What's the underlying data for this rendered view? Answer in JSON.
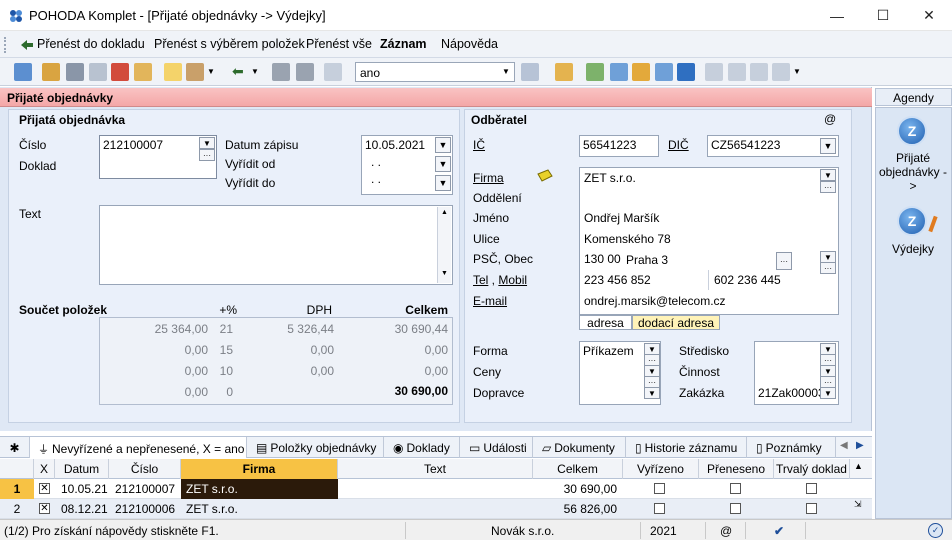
{
  "window": {
    "title": "POHODA Komplet - [Přijaté objednávky -> Výdejky]",
    "min": "—",
    "max": "☐",
    "close": "✕"
  },
  "menu": {
    "items": [
      {
        "label": "Přenést do dokladu"
      },
      {
        "label": "Přenést s výběrem položek"
      },
      {
        "label": "Přenést vše"
      },
      {
        "label": "Záznam"
      },
      {
        "label": "Nápověda"
      }
    ]
  },
  "toolbar": {
    "filter_value": "ano"
  },
  "agenda_header": "Přijaté objednávky",
  "order": {
    "section": "Přijatá objednávka",
    "cislo_label": "Číslo",
    "cislo": "212100007",
    "doklad_label": "Doklad",
    "datum_zapisu_label": "Datum zápisu",
    "datum_zapisu": "10.05.2021",
    "vyridit_od_label": "Vyřídit od",
    "vyridit_od": ". .",
    "vyridit_do_label": "Vyřídit do",
    "vyridit_do": ". .",
    "text_label": "Text",
    "sum_label": "Součet položek",
    "col_pct": "+%",
    "col_dph": "DPH",
    "col_celkem": "Celkem",
    "rows": [
      {
        "base": "25 364,00",
        "pct": "21",
        "dph": "5 326,44",
        "total": "30 690,44"
      },
      {
        "base": "0,00",
        "pct": "15",
        "dph": "0,00",
        "total": "0,00"
      },
      {
        "base": "0,00",
        "pct": "10",
        "dph": "0,00",
        "total": "0,00"
      },
      {
        "base": "0,00",
        "pct": "0",
        "dph": "",
        "total": "30 690,00"
      }
    ]
  },
  "customer": {
    "section": "Odběratel",
    "at": "@",
    "ic_label": "IČ",
    "ic": "56541223",
    "dic_label": "DIČ",
    "dic": "CZ56541223",
    "firma_label": "Firma",
    "firma": "ZET s.r.o.",
    "oddeleni_label": "Oddělení",
    "oddeleni": "",
    "jmeno_label": "Jméno",
    "jmeno": "Ondřej Maršík",
    "ulice_label": "Ulice",
    "ulice": "Komenského 78",
    "psc_label": "PSČ, Obec",
    "psc": "130 00",
    "obec": "Praha 3",
    "tel_label": "Tel",
    "mobil_label": "Mobil",
    "tel": "223 456 852",
    "mobil": "602 236 445",
    "email_label": "E-mail",
    "email": "ondrej.marsik@telecom.cz",
    "tab_adresa": "adresa",
    "tab_dodaci": "dodací adresa",
    "forma_label": "Forma",
    "forma": "Příkazem",
    "ceny_label": "Ceny",
    "dopravce_label": "Dopravce",
    "stredisko_label": "Středisko",
    "cinnost_label": "Činnost",
    "zakazka_label": "Zakázka",
    "zakazka": "21Zak00003"
  },
  "agendy": {
    "title": "Agendy",
    "items": [
      {
        "label": "Přijaté objednávky ->"
      },
      {
        "label": "Výdejky"
      }
    ]
  },
  "tabs": [
    {
      "label": "Nevyřízené a nepřenesené, X = ano"
    },
    {
      "label": "Položky objednávky"
    },
    {
      "label": "Doklady"
    },
    {
      "label": "Události"
    },
    {
      "label": "Dokumenty"
    },
    {
      "label": "Historie záznamu"
    },
    {
      "label": "Poznámky"
    }
  ],
  "grid": {
    "columns": [
      "X",
      "Datum",
      "Číslo",
      "Firma",
      "Text",
      "Celkem",
      "Vyřízeno",
      "Přeneseno",
      "Trvalý doklad"
    ],
    "rows": [
      {
        "n": "1",
        "x": "✕",
        "datum": "10.05.21",
        "cislo": "212100007",
        "firma": "ZET s.r.o.",
        "text": "",
        "celkem": "30 690,00"
      },
      {
        "n": "2",
        "x": "✕",
        "datum": "08.12.21",
        "cislo": "212100006",
        "firma": "ZET s.r.o.",
        "text": "",
        "celkem": "56 826,00"
      }
    ]
  },
  "status": {
    "help": "(1/2) Pro získání nápovědy stiskněte F1.",
    "company": "Novák s.r.o.",
    "year": "2021",
    "at": "@"
  }
}
